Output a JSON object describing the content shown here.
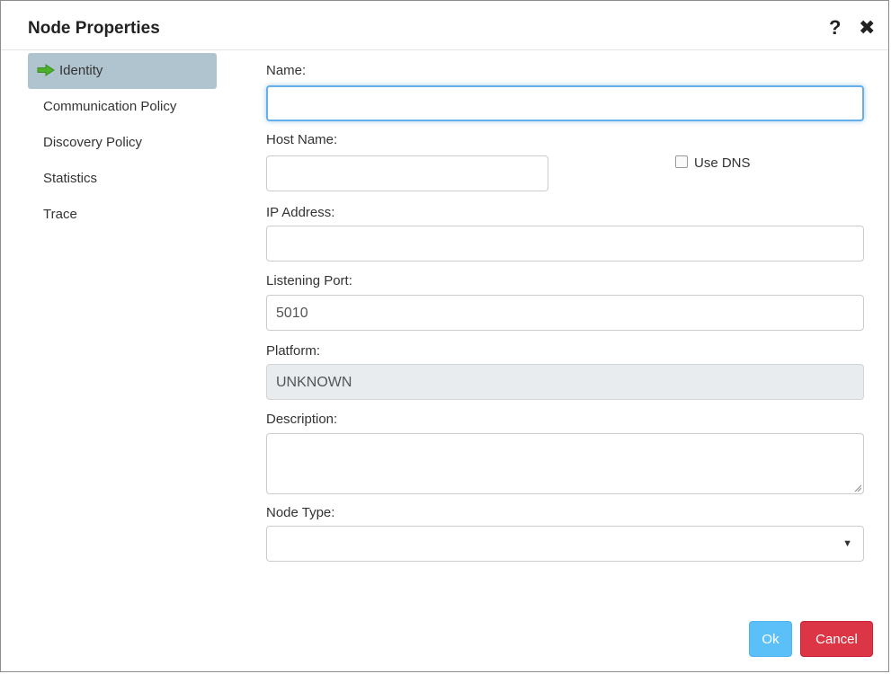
{
  "dialog": {
    "title": "Node Properties",
    "help_icon": "question-mark-icon",
    "close_icon": "close-icon"
  },
  "sidebar": {
    "items": [
      {
        "label": "Identity",
        "active": true,
        "icon": "green-arrow-right-icon"
      },
      {
        "label": "Communication Policy",
        "active": false
      },
      {
        "label": "Discovery Policy",
        "active": false
      },
      {
        "label": "Statistics",
        "active": false
      },
      {
        "label": "Trace",
        "active": false
      }
    ]
  },
  "form": {
    "name": {
      "label": "Name:",
      "value": ""
    },
    "host_name": {
      "label": "Host Name:",
      "value": ""
    },
    "use_dns": {
      "label": "Use DNS",
      "checked": false
    },
    "ip_address": {
      "label": "IP Address:",
      "value": ""
    },
    "listening_port": {
      "label": "Listening Port:",
      "value": "5010"
    },
    "platform": {
      "label": "Platform:",
      "value": "UNKNOWN",
      "disabled": true
    },
    "description": {
      "label": "Description:",
      "value": ""
    },
    "node_type": {
      "label": "Node Type:",
      "value": ""
    }
  },
  "buttons": {
    "ok_label": "Ok",
    "cancel_label": "Cancel"
  },
  "colors": {
    "active_nav_bg": "#b0c4cf",
    "ok_button": "#5bc0f8",
    "cancel_button": "#dc3545",
    "focus_border": "#66afe9",
    "arrow_green": "#4caf2a"
  }
}
